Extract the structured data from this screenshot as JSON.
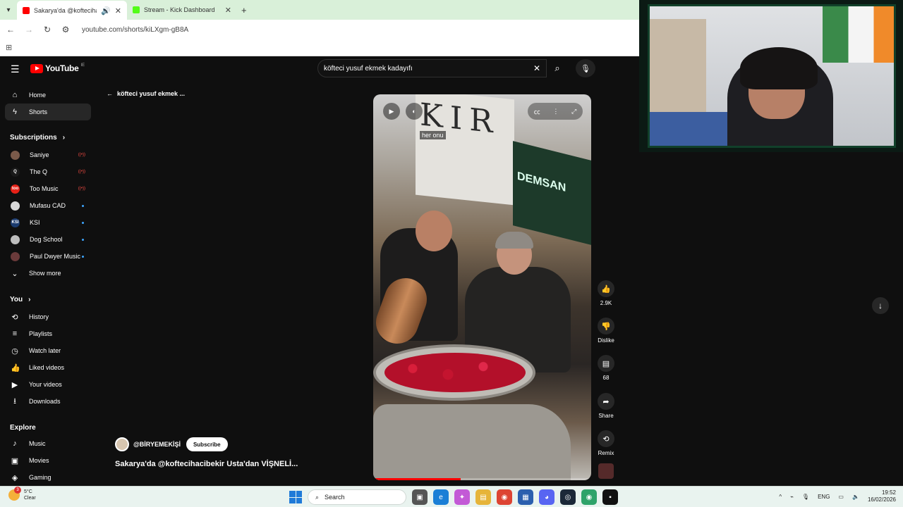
{
  "browser": {
    "tabs": [
      {
        "title": "Sakarya'da @koftecihacibekir",
        "active": true,
        "favicon_color": "#ff0000"
      },
      {
        "title": "Stream - Kick Dashboard",
        "active": false,
        "favicon_color": "#53fc18"
      }
    ],
    "url": "youtube.com/shorts/kiLXgm-gB8A"
  },
  "youtube": {
    "logo_text": "YouTube",
    "country_code": "IE",
    "search_value": "köfteci yusuf ekmek kadayıfı",
    "back_label": "köfteci yusuf ekmek ...",
    "sidebar": {
      "main": [
        {
          "label": "Home",
          "icon": "home-icon"
        },
        {
          "label": "Shorts",
          "icon": "shorts-icon",
          "active": true
        }
      ],
      "subscriptions_heading": "Subscriptions",
      "subscriptions": [
        {
          "label": "Saniye",
          "status": "live",
          "color": "#7a5a4a",
          "initial": ""
        },
        {
          "label": "The Q",
          "status": "live",
          "color": "#1a1a1a",
          "initial": "Q"
        },
        {
          "label": "Too Music",
          "status": "live",
          "color": "#e62117",
          "initial": "too"
        },
        {
          "label": "Mufasu CAD",
          "status": "new",
          "color": "#d9d9d9",
          "initial": ""
        },
        {
          "label": "KSI",
          "status": "new",
          "color": "#1b3b6f",
          "initial": "KSI"
        },
        {
          "label": "Dog School",
          "status": "new",
          "color": "#bdbdbd",
          "initial": ""
        },
        {
          "label": "Paul Dwyer Music",
          "status": "new",
          "color": "#6a3a3a",
          "initial": ""
        }
      ],
      "show_more": "Show more",
      "you_heading": "You",
      "you": [
        {
          "label": "History",
          "icon": "history-icon"
        },
        {
          "label": "Playlists",
          "icon": "playlists-icon"
        },
        {
          "label": "Watch later",
          "icon": "watch-later-icon"
        },
        {
          "label": "Liked videos",
          "icon": "liked-icon"
        },
        {
          "label": "Your videos",
          "icon": "your-videos-icon"
        },
        {
          "label": "Downloads",
          "icon": "downloads-icon"
        }
      ],
      "explore_heading": "Explore",
      "explore": [
        {
          "label": "Music",
          "icon": "music-icon"
        },
        {
          "label": "Movies",
          "icon": "movies-icon"
        },
        {
          "label": "Gaming",
          "icon": "gaming-icon"
        }
      ]
    },
    "video": {
      "caption": "her onu",
      "sign_text": "KIR",
      "shop_sign": "DEMSAN",
      "progress": 0.4
    },
    "channel": {
      "handle": "@BİRYEMEKİŞİ",
      "subscribe": "Subscribe"
    },
    "video_title": "Sakarya'da @koftecihacibekir  Usta'dan VİŞNELİ...",
    "actions": [
      {
        "label": "2.9K",
        "icon": "like-icon"
      },
      {
        "label": "Dislike",
        "icon": "dislike-icon"
      },
      {
        "label": "68",
        "icon": "comment-icon"
      },
      {
        "label": "Share",
        "icon": "share-icon"
      },
      {
        "label": "Remix",
        "icon": "remix-icon"
      }
    ]
  },
  "taskbar": {
    "temperature": "5°C",
    "condition": "Clear",
    "notification_count": "3",
    "search_placeholder": "Search",
    "language": "ENG",
    "time": "19:52",
    "date": "16/02/2026"
  }
}
